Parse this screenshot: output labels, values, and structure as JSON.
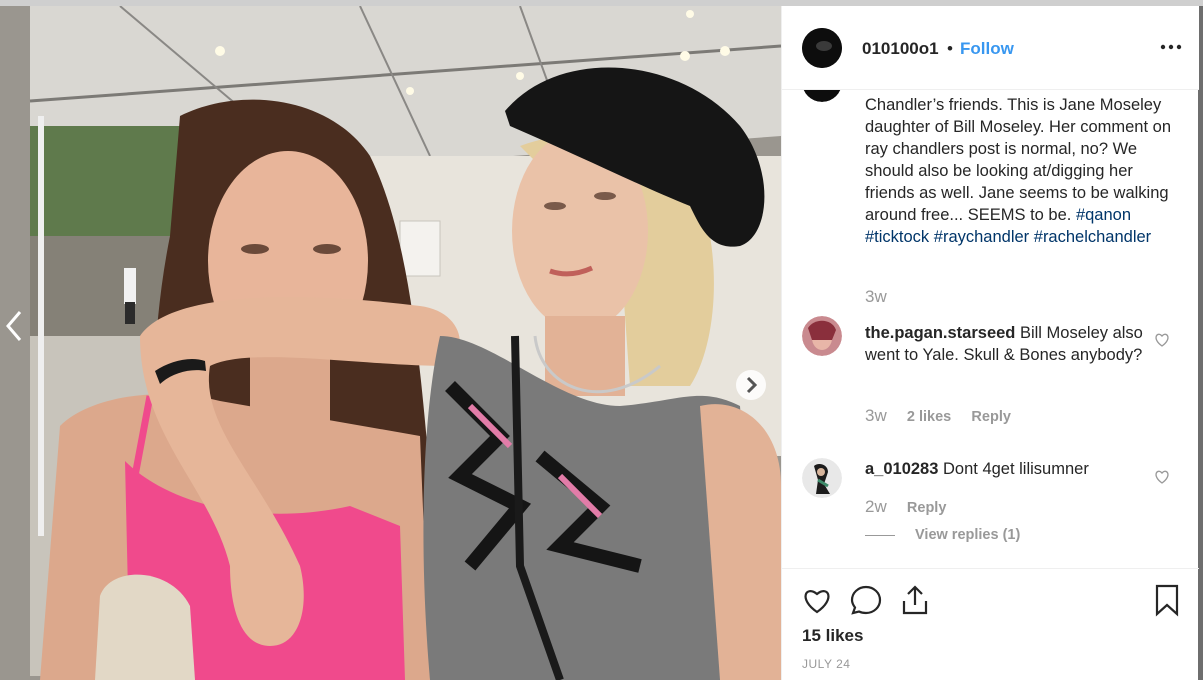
{
  "post": {
    "username": "010100o1",
    "separator": "•",
    "follow_label": "Follow",
    "more_icon": "more-horizontal-icon"
  },
  "caption": {
    "text_before": "Chandler’s friends. This is Jane Moseley daughter of Bill Moseley. Her comment on ray chandlers post is normal, no? We should also be looking at/digging her friends as well. Jane seems to be walking around free... SEEMS to be. ",
    "hashtags": [
      "#qanon",
      "#ticktock",
      "#raychandler",
      "#rachelchandler"
    ],
    "time": "3w"
  },
  "comments": [
    {
      "username": "the.pagan.starseed",
      "text": " Bill Moseley also went to Yale. Skull & Bones anybody?",
      "time": "3w",
      "likes": "2 likes",
      "reply": "Reply"
    },
    {
      "username": "a_010283",
      "text": " Dont 4get lilisumner",
      "time": "2w",
      "reply": "Reply",
      "view_replies": "View replies (1)"
    }
  ],
  "actions": {
    "like_icon": "heart-icon",
    "comment_icon": "comment-icon",
    "share_icon": "share-icon",
    "save_icon": "bookmark-icon"
  },
  "likes_count": "15 likes",
  "date": "JULY 24",
  "colors": {
    "link_blue": "#3897f0",
    "hashtag_blue": "#003569",
    "text": "#262626",
    "muted": "#999999"
  }
}
